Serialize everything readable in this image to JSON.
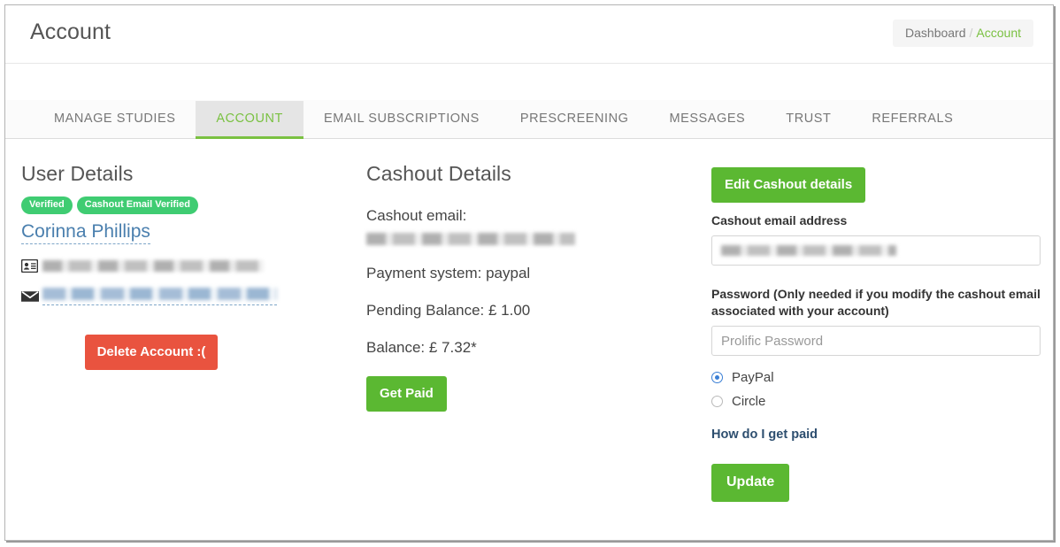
{
  "header": {
    "title": "Account",
    "breadcrumb": {
      "parent": "Dashboard",
      "separator": "/",
      "current": "Account"
    }
  },
  "tabs": [
    {
      "label": "MANAGE STUDIES",
      "active": false
    },
    {
      "label": "ACCOUNT",
      "active": true
    },
    {
      "label": "EMAIL SUBSCRIPTIONS",
      "active": false
    },
    {
      "label": "PRESCREENING",
      "active": false
    },
    {
      "label": "MESSAGES",
      "active": false
    },
    {
      "label": "TRUST",
      "active": false
    },
    {
      "label": "REFERRALS",
      "active": false
    }
  ],
  "user_details": {
    "title": "User Details",
    "badges": [
      "Verified",
      "Cashout Email Verified"
    ],
    "name": "Corinna Phillips",
    "id_row_icon": "id-card-icon",
    "email_row_icon": "envelope-icon",
    "delete_button": "Delete Account :("
  },
  "cashout_details": {
    "title": "Cashout Details",
    "email_label": "Cashout email:",
    "payment_system": "Payment system: paypal",
    "pending_balance": "Pending Balance: £ 1.00",
    "balance": "Balance: £ 7.32*",
    "get_paid_button": "Get Paid"
  },
  "cashout_form": {
    "edit_button": "Edit Cashout details",
    "email_label": "Cashout email address",
    "password_label": "Password (Only needed if you modify the cashout email associated with your account)",
    "password_placeholder": "Prolific Password",
    "radio_options": [
      {
        "label": "PayPal",
        "selected": true
      },
      {
        "label": "Circle",
        "selected": false
      }
    ],
    "help_link": "How do I get paid",
    "update_button": "Update"
  },
  "colors": {
    "green": "#5bb832",
    "badge_green": "#3fcc72",
    "tab_green": "#7ac142",
    "danger_red": "#e9533f",
    "link_blue": "#4a7fae",
    "radio_blue": "#3a7fd5",
    "help_blue": "#2d4e6f"
  }
}
